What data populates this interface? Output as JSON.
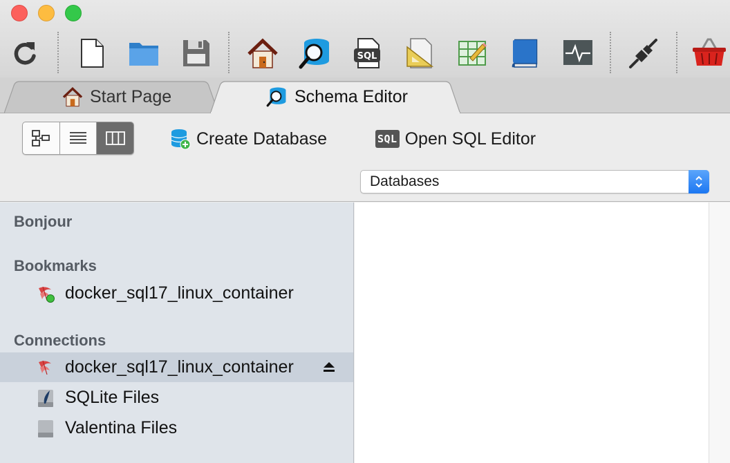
{
  "window": {
    "traffic_lights": [
      "close",
      "minimize",
      "zoom"
    ]
  },
  "toolbar": {
    "items": [
      {
        "name": "refresh-icon"
      },
      {
        "name": "new-file-icon"
      },
      {
        "name": "open-folder-icon"
      },
      {
        "name": "save-icon"
      },
      {
        "name": "home-icon"
      },
      {
        "name": "schema-search-icon"
      },
      {
        "name": "sql-file-icon"
      },
      {
        "name": "design-ruler-icon"
      },
      {
        "name": "table-edit-icon"
      },
      {
        "name": "book-icon"
      },
      {
        "name": "activity-monitor-icon"
      },
      {
        "name": "connect-plug-icon"
      },
      {
        "name": "basket-icon"
      }
    ],
    "sql_icon_text": "SQL"
  },
  "tabs": {
    "start_page": "Start Page",
    "schema_editor": "Schema Editor"
  },
  "subtoolbar": {
    "view_modes": [
      "diagram-view",
      "list-view",
      "column-view"
    ],
    "selected_view": "column-view",
    "create_database": "Create Database",
    "open_sql_editor": "Open SQL Editor",
    "sql_badge": "SQL",
    "scope_select": {
      "value": "Databases"
    }
  },
  "sidebar": {
    "sections": [
      {
        "header": "Bonjour",
        "items": []
      },
      {
        "header": "Bookmarks",
        "items": [
          {
            "label": "docker_sql17_linux_container",
            "icon": "mssql-bookmark-icon",
            "status": "connected"
          }
        ]
      },
      {
        "header": "Connections",
        "items": [
          {
            "label": "docker_sql17_linux_container",
            "icon": "mssql-connection-icon",
            "selected": true,
            "eject": true
          },
          {
            "label": "SQLite Files",
            "icon": "sqlite-files-icon"
          },
          {
            "label": "Valentina Files",
            "icon": "valentina-files-icon"
          }
        ]
      }
    ]
  },
  "colors": {
    "accent": "#1c77f2",
    "sidebar_bg": "#dfe4ea",
    "selection_bg": "#c9d1db",
    "header_text": "#555b63"
  }
}
